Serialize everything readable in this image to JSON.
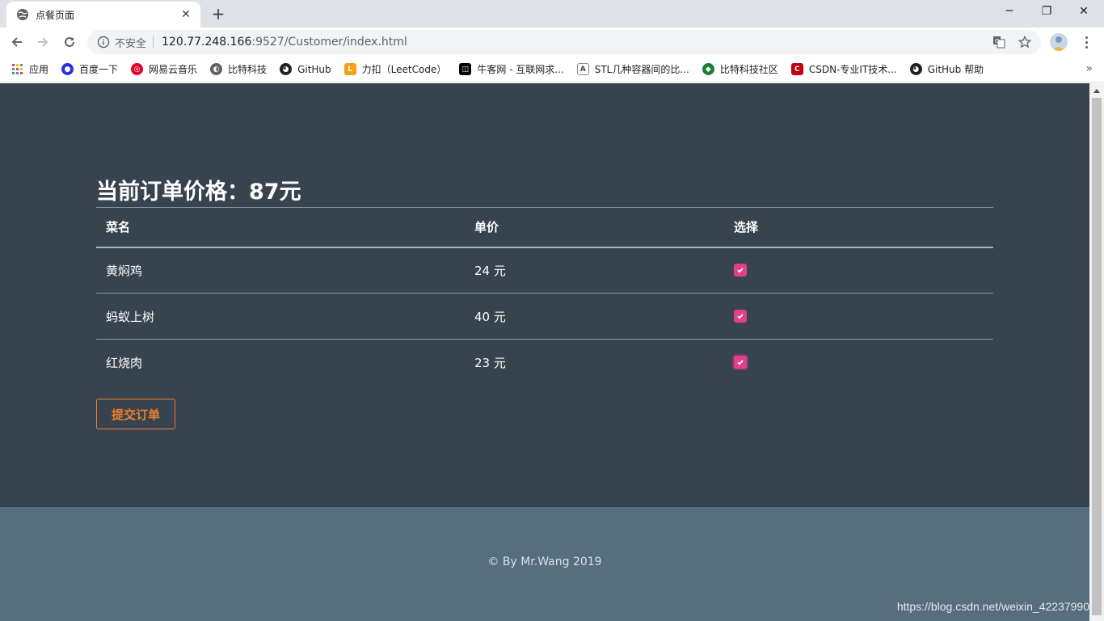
{
  "browser": {
    "tab_title": "点餐页面",
    "tab_close": "✕",
    "new_tab": "+",
    "window_min": "─",
    "window_max": "❐",
    "window_close": "✕",
    "security_label": "不安全",
    "url_host": "120.77.248.166",
    "url_rest": ":9527/Customer/index.html"
  },
  "bookmarks": [
    {
      "label": "应用",
      "icon": "apps-grid-icon",
      "color": "#ea4335"
    },
    {
      "label": "百度一下",
      "icon": "baidu-paw-icon",
      "color": "#2932e1"
    },
    {
      "label": "网易云音乐",
      "icon": "netease-music-icon",
      "color": "#e60026"
    },
    {
      "label": "比特科技",
      "icon": "globe-icon",
      "color": "#5f6368"
    },
    {
      "label": "GitHub",
      "icon": "github-icon",
      "color": "#202124"
    },
    {
      "label": "力扣（LeetCode）",
      "icon": "leetcode-icon",
      "color": "#f89f1b"
    },
    {
      "label": "牛客网 - 互联网求...",
      "icon": "nowcoder-icon",
      "color": "#000000"
    },
    {
      "label": "STL几种容器间的比...",
      "icon": "stl-icon",
      "color": "#444444"
    },
    {
      "label": "比特科技社区",
      "icon": "bit-community-icon",
      "color": "#1b7f3a"
    },
    {
      "label": "CSDN-专业IT技术...",
      "icon": "csdn-icon",
      "color": "#c5000a"
    },
    {
      "label": "GitHub 帮助",
      "icon": "github-icon",
      "color": "#202124"
    }
  ],
  "bookmarks_more": "»",
  "order": {
    "title": "当前订单价格：87元",
    "headers": [
      "菜名",
      "单价",
      "选择"
    ],
    "rows": [
      {
        "name": "黄焖鸡",
        "price": "24 元",
        "selected": true
      },
      {
        "name": "蚂蚁上树",
        "price": "40 元",
        "selected": true
      },
      {
        "name": "红烧肉",
        "price": "23 元",
        "selected": true
      }
    ],
    "submit_label": "提交订单"
  },
  "footer": {
    "copyright": "© By Mr.Wang 2019"
  },
  "watermark": "https://blog.csdn.net/weixin_42237990",
  "colors": {
    "main_bg": "#37444f",
    "footer_bg": "#566e7e",
    "checkbox": "#e43f8b",
    "accent_button": "#f07e2a"
  }
}
